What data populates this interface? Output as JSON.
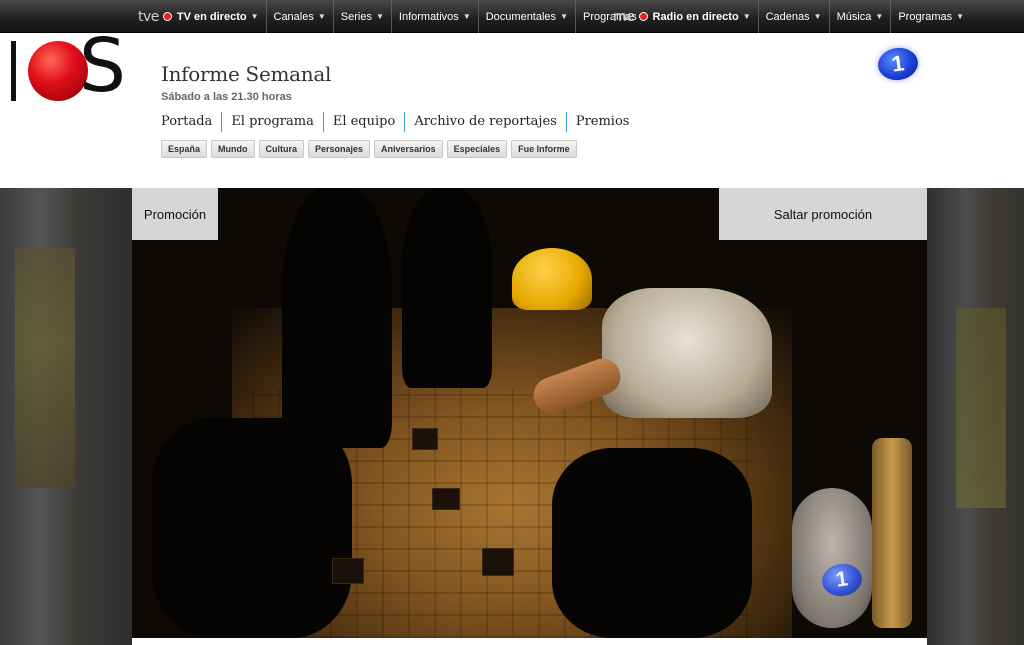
{
  "topbar": {
    "tve": {
      "brand": "tve",
      "live_label": "TV en directo",
      "menus": [
        "Canales",
        "Series",
        "Informativos",
        "Documentales",
        "Programas"
      ]
    },
    "rne": {
      "brand": "rne",
      "live_label": "Radio en directo",
      "menus": [
        "Cadenas",
        "Música",
        "Programas"
      ]
    }
  },
  "header": {
    "logo_icon": "informe-semanal-logo",
    "title": "Informe Semanal",
    "subtitle": "Sábado a las 21.30 horas",
    "channel_badge": "1"
  },
  "nav": [
    "Portada",
    "El programa",
    "El equipo",
    "Archivo de reportajes",
    "Premios"
  ],
  "tags": [
    "España",
    "Mundo",
    "Cultura",
    "Personajes",
    "Aniversarios",
    "Especiales",
    "Fue Informe"
  ],
  "video": {
    "promo_label": "Promoción",
    "skip_label": "Saltar promoción",
    "watermark": "1"
  },
  "colors": {
    "accent_nav_divider": "#3aa0c8",
    "logo_red": "#e3101a",
    "tve_blue": "#1b3fd6"
  }
}
